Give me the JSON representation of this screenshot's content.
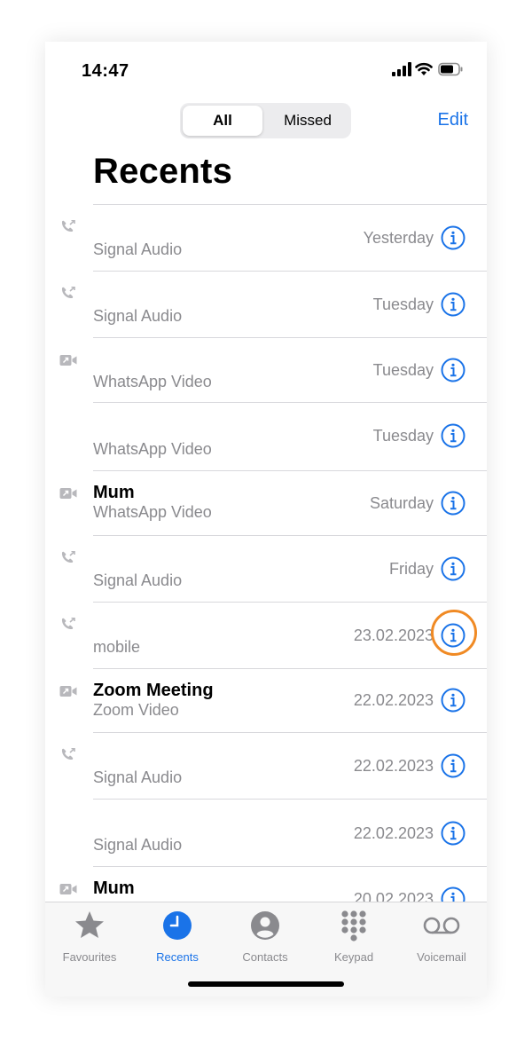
{
  "status_bar": {
    "time": "14:47",
    "icons": [
      "cellular-signal-icon",
      "wifi-icon",
      "battery-icon"
    ]
  },
  "segmented": {
    "all": "All",
    "missed": "Missed",
    "selected": "All"
  },
  "header": {
    "edit": "Edit",
    "title": "Recents"
  },
  "calls": [
    {
      "name": "",
      "type": "Signal Audio",
      "date": "Yesterday",
      "icon": "phone-call-icon"
    },
    {
      "name": "",
      "type": "Signal Audio",
      "date": "Tuesday",
      "icon": "phone-call-icon"
    },
    {
      "name": "",
      "type": "WhatsApp Video",
      "date": "Tuesday",
      "icon": "video-call-icon"
    },
    {
      "name": "",
      "type": "WhatsApp Video",
      "date": "Tuesday",
      "icon": ""
    },
    {
      "name": "Mum",
      "type": "WhatsApp Video",
      "date": "Saturday",
      "icon": "video-call-icon"
    },
    {
      "name": "",
      "type": "Signal Audio",
      "date": "Friday",
      "icon": "phone-call-icon"
    },
    {
      "name": "",
      "type": "mobile",
      "date": "23.02.2023",
      "icon": "phone-call-icon",
      "highlighted": true
    },
    {
      "name": "Zoom Meeting",
      "type": "Zoom Video",
      "date": "22.02.2023",
      "icon": "video-call-icon"
    },
    {
      "name": "",
      "type": "Signal Audio",
      "date": "22.02.2023",
      "icon": "phone-call-icon"
    },
    {
      "name": "",
      "type": "Signal Audio",
      "date": "22.02.2023",
      "icon": ""
    },
    {
      "name": "Mum",
      "type": "",
      "date": "20.02.2023",
      "icon": "video-call-icon"
    }
  ],
  "tabbar": {
    "tabs": [
      {
        "label": "Favourites",
        "icon": "star-icon"
      },
      {
        "label": "Recents",
        "icon": "clock-icon",
        "active": true
      },
      {
        "label": "Contacts",
        "icon": "person-icon"
      },
      {
        "label": "Keypad",
        "icon": "keypad-icon"
      },
      {
        "label": "Voicemail",
        "icon": "voicemail-icon"
      }
    ]
  },
  "colors": {
    "accent": "#1a73e8",
    "highlight": "#f08a24",
    "secondary_text": "#8a8a8e"
  }
}
